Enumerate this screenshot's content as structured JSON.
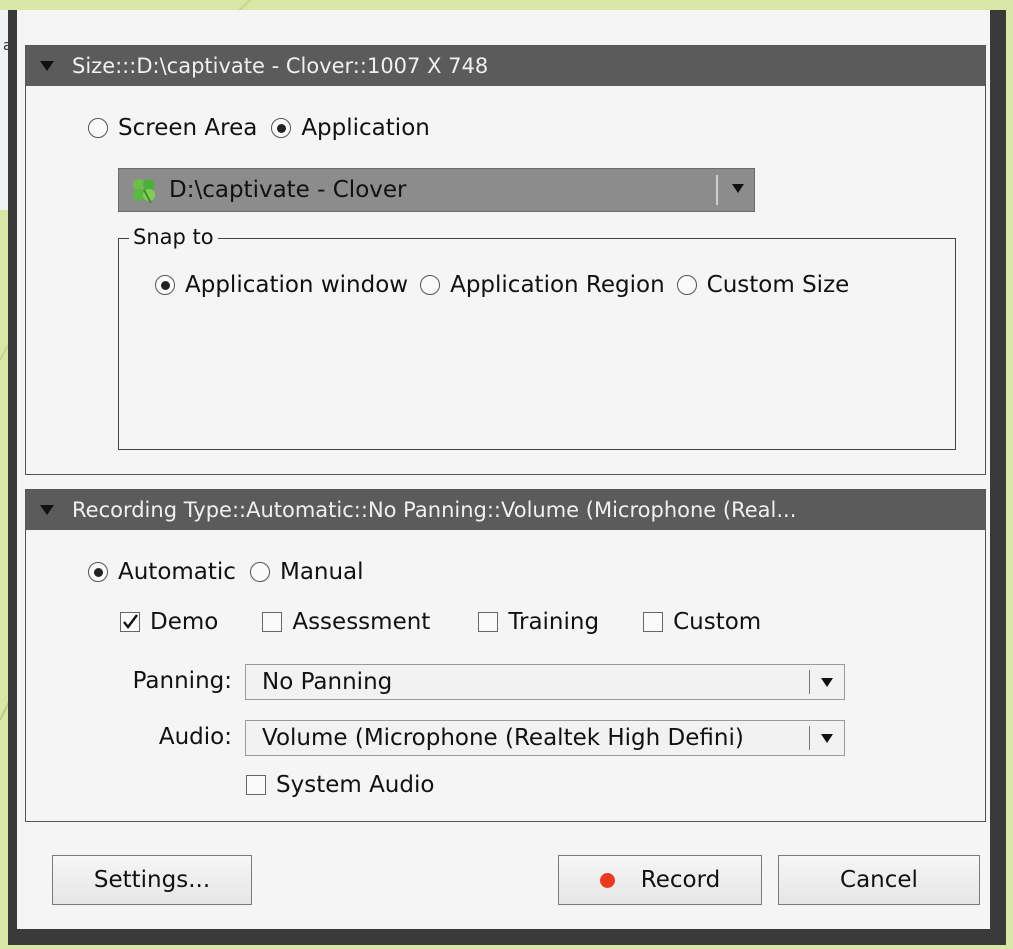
{
  "background": {
    "edge_char": "a"
  },
  "size_panel": {
    "header": "Size:::D:\\captivate - Clover::1007 X 748",
    "mode_options": [
      {
        "label": "Screen Area",
        "selected": false
      },
      {
        "label": "Application",
        "selected": true
      }
    ],
    "application_select": {
      "value": "D:\\captivate - Clover"
    },
    "snap_to": {
      "legend": "Snap to",
      "options": [
        {
          "label": "Application window",
          "selected": true
        },
        {
          "label": "Application Region",
          "selected": false
        },
        {
          "label": "Custom Size",
          "selected": false
        }
      ]
    }
  },
  "recording_panel": {
    "header": "Recording Type::Automatic::No Panning::Volume (Microphone (Real...",
    "type_options": [
      {
        "label": "Automatic",
        "selected": true
      },
      {
        "label": "Manual",
        "selected": false
      }
    ],
    "modes": [
      {
        "label": "Demo",
        "checked": true
      },
      {
        "label": "Assessment",
        "checked": false
      },
      {
        "label": "Training",
        "checked": false
      },
      {
        "label": "Custom",
        "checked": false
      }
    ],
    "panning": {
      "label": "Panning:",
      "value": "No Panning"
    },
    "audio": {
      "label": "Audio:",
      "value": "Volume (Microphone (Realtek High Defini)"
    },
    "system_audio": {
      "label": "System Audio",
      "checked": false
    }
  },
  "buttons": {
    "settings": "Settings...",
    "record": "Record",
    "cancel": "Cancel"
  },
  "colors": {
    "record_dot": "#ea3a1e",
    "header_bg": "#5b5b5b",
    "desktop_bg": "#d9e6a6"
  },
  "icons": {
    "app_icon": "clover-icon",
    "collapse": "triangle-down-icon",
    "dropdown": "chevron-down-icon"
  }
}
